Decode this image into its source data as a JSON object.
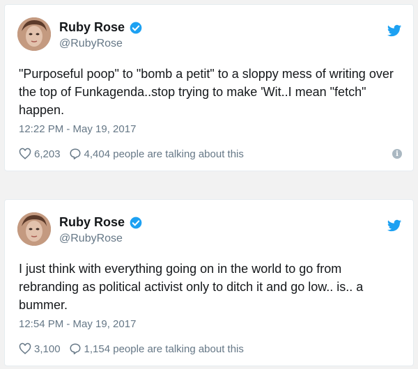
{
  "colors": {
    "accent": "#1da1f2",
    "muted": "#657786",
    "text": "#14171a"
  },
  "tweets": [
    {
      "name": "Ruby Rose",
      "handle": "@RubyRose",
      "text": "\"Purposeful poop\" to \"bomb a petit\" to a sloppy mess of writing over the top of Funkagenda..stop trying to make 'Wit..I mean \"fetch\" happen.",
      "time": "12:22 PM - May 19, 2017",
      "likes": "6,203",
      "talking": "4,404 people are talking about this",
      "icons": [
        "verified-badge-icon",
        "twitter-bird-icon",
        "heart-icon",
        "speech-bubble-icon",
        "info-icon"
      ]
    },
    {
      "name": "Ruby Rose",
      "handle": "@RubyRose",
      "text": "I just think with everything going on in the world to go from rebranding as political activist only to ditch it and go low.. is.. a bummer.",
      "time": "12:54 PM - May 19, 2017",
      "likes": "3,100",
      "talking": "1,154 people are talking about this",
      "icons": [
        "verified-badge-icon",
        "twitter-bird-icon",
        "heart-icon",
        "speech-bubble-icon"
      ]
    }
  ]
}
